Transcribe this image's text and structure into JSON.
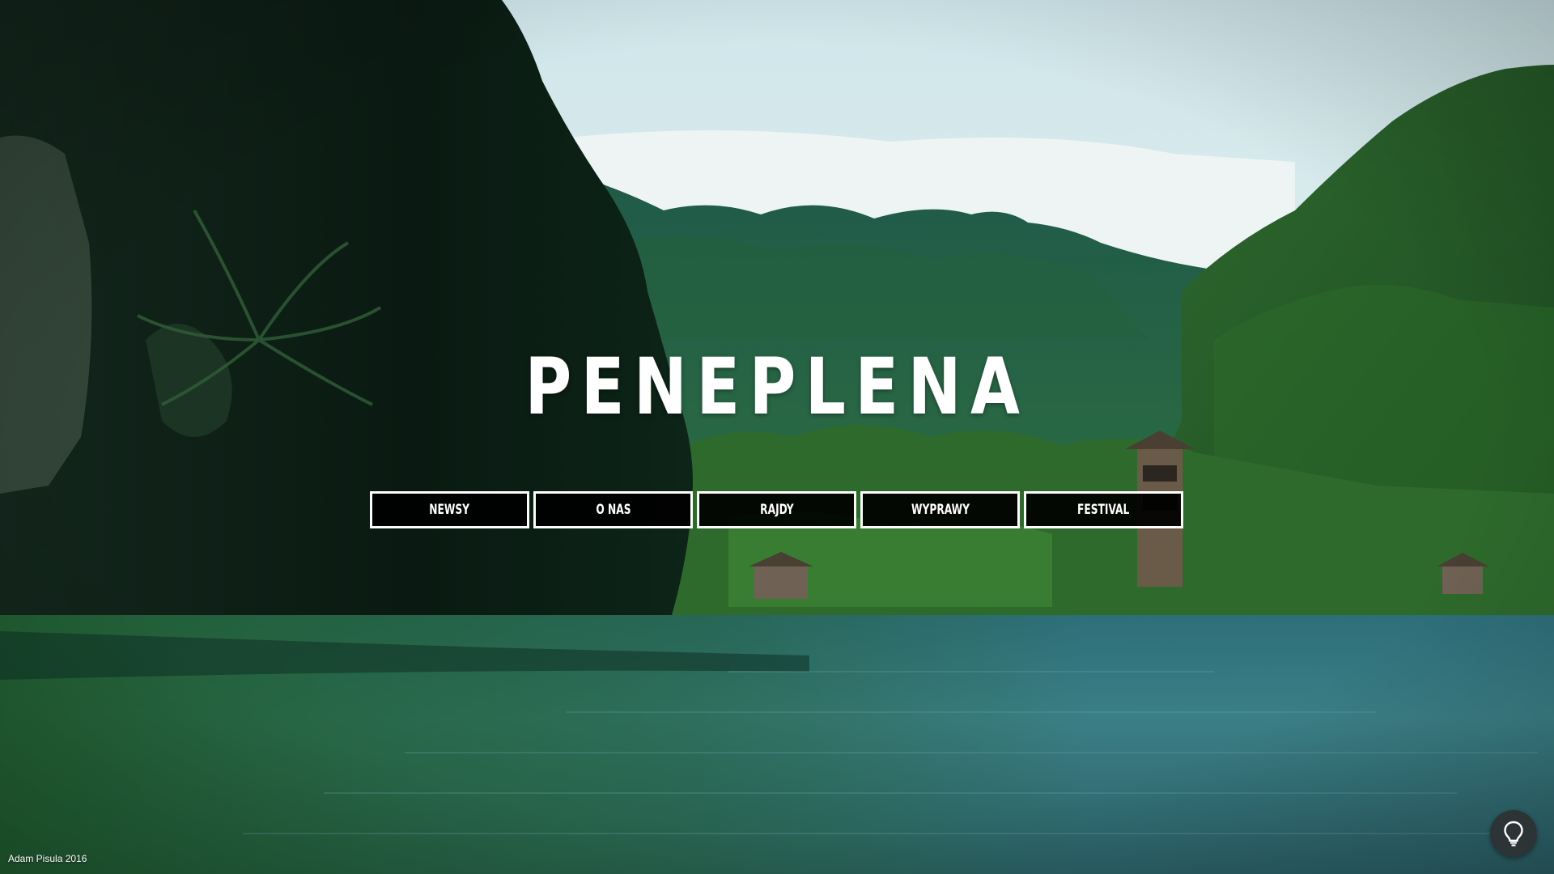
{
  "site": {
    "brand": "PENEPLENA"
  },
  "nav": {
    "items": [
      {
        "label": "NEWSY"
      },
      {
        "label": "O NAS"
      },
      {
        "label": "RAJDY"
      },
      {
        "label": "WYPRAWY"
      },
      {
        "label": "FESTIVAL"
      }
    ]
  },
  "footer": {
    "credit": "Adam Pisula 2016"
  },
  "icons": {
    "help": "lightbulb-icon"
  },
  "colors": {
    "nav_background": "#000000",
    "nav_border": "#ffffff",
    "brand_text": "#ffffff",
    "help_button": "#2d3436"
  }
}
